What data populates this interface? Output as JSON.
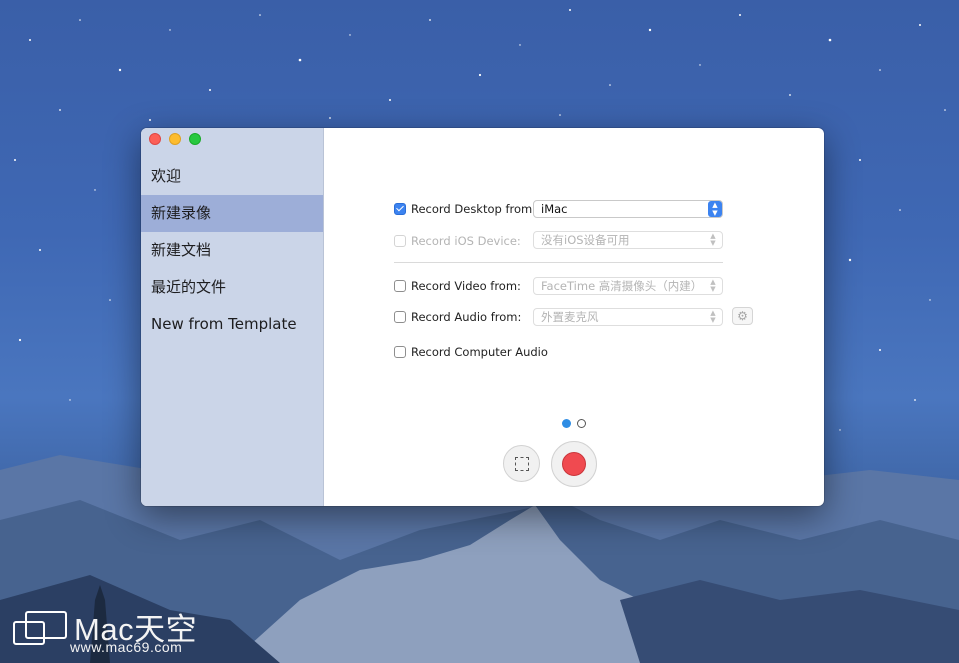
{
  "sidebar": {
    "items": [
      {
        "label": "欢迎"
      },
      {
        "label": "新建录像",
        "active": true
      },
      {
        "label": "新建文档"
      },
      {
        "label": "最近的文件"
      },
      {
        "label": "New from Template"
      }
    ]
  },
  "options": {
    "record_desktop": {
      "label": "Record Desktop from:",
      "checked": true,
      "value": "iMac"
    },
    "record_ios": {
      "label": "Record iOS Device:",
      "checked": false,
      "enabled": false,
      "value": "没有iOS设备可用"
    },
    "record_video": {
      "label": "Record Video from:",
      "checked": false,
      "value": "FaceTime 高清摄像头（内建）"
    },
    "record_audio": {
      "label": "Record Audio from:",
      "checked": false,
      "value": "外置麦克风"
    },
    "record_computer_audio": {
      "label": "Record Computer Audio",
      "checked": false
    }
  },
  "pager": {
    "pages": 2,
    "current": 1
  },
  "watermark": {
    "brand": "Mac天空",
    "url": "www.mac69.com"
  },
  "icons": {
    "close": "close-icon",
    "minimize": "minimize-icon",
    "zoom": "zoom-icon",
    "gear": "gear-icon",
    "area_select": "area-select-icon",
    "record": "record-icon"
  },
  "colors": {
    "accent": "#3c83f0",
    "record": "#f04a50",
    "sidebar_active": "#9daed8"
  }
}
